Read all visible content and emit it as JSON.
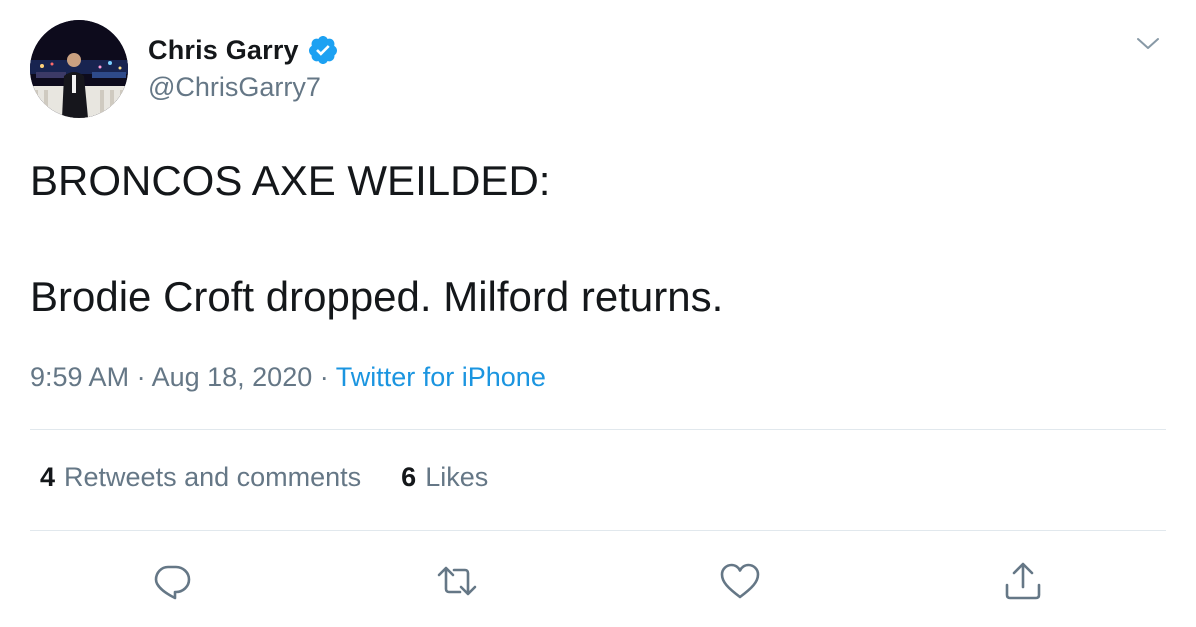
{
  "user": {
    "name": "Chris Garry",
    "handle": "@ChrisGarry7",
    "verified": true
  },
  "tweet": {
    "lines": [
      "BRONCOS AXE WEILDED:",
      "Brodie Croft dropped. Milford returns."
    ]
  },
  "meta": {
    "time": "9:59 AM",
    "separator": " · ",
    "date": "Aug 18, 2020",
    "source": "Twitter for iPhone"
  },
  "stats": {
    "retweets_comments_count": "4",
    "retweets_comments_label": "Retweets and comments",
    "likes_count": "6",
    "likes_label": "Likes"
  },
  "icons": {
    "verified": "verified-badge-icon",
    "menu": "chevron-down-icon",
    "reply": "reply-icon",
    "retweet": "retweet-icon",
    "like": "heart-icon",
    "share": "share-icon"
  },
  "colors": {
    "text": "#14171a",
    "secondary": "#657786",
    "link": "#1b95e0",
    "verified": "#1da1f2",
    "divider": "#e1e8ed"
  }
}
